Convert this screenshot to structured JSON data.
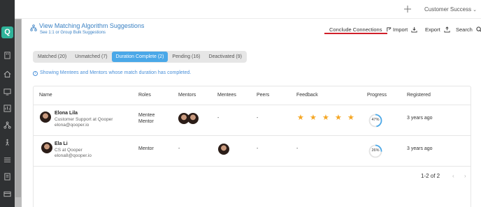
{
  "topbar": {
    "plus_icon": "plus-icon",
    "user_menu": "Customer Success"
  },
  "header": {
    "title": "View Matching Algorithm Suggestions",
    "subtitle": "See 1:1 or Group Bulk Suggestions",
    "actions": {
      "conclude": "Conclude Connections",
      "import": "Import",
      "export": "Export",
      "search": "Search"
    }
  },
  "tabs": [
    {
      "label": "Matched (20)",
      "active": false
    },
    {
      "label": "Unmatched (7)",
      "active": false
    },
    {
      "label": "Duration Complete (2)",
      "active": true
    },
    {
      "label": "Pending (16)",
      "active": false
    },
    {
      "label": "Deactivated (9)",
      "active": false
    }
  ],
  "info": "Showing Mentees and Mentors whose match duration has completed.",
  "table": {
    "columns": [
      "Name",
      "Roles",
      "Mentors",
      "Mentees",
      "Peers",
      "Feedback",
      "Progress",
      "Registered"
    ],
    "rows": [
      {
        "name": "Elona Lila",
        "title": "Customer Support at Qooper",
        "email": "elona@qooper.io",
        "roles": [
          "Mentee",
          "Mentor"
        ],
        "mentors": "",
        "mentees": "-",
        "peers": "-",
        "feedback_stars": 5,
        "progress": "47%",
        "progress_value": 47,
        "registered": "3 years ago"
      },
      {
        "name": "Ela Li",
        "title": "CS at Qooper",
        "email": "elona8@qooper.io",
        "roles": [
          "Mentor"
        ],
        "mentors": "-",
        "mentees": "",
        "peers": "-",
        "feedback": "-",
        "progress": "26%",
        "progress_value": 26,
        "registered": "3 years ago"
      }
    ]
  },
  "pagination": {
    "range": "1-2 of 2",
    "prev": "‹",
    "next": "›"
  },
  "colors": {
    "accent": "#4aa8e8",
    "link": "#3b82c4",
    "star": "#f5a623",
    "underline": "#d0202a",
    "rail": "#2f3133",
    "logo": "#2fb39a"
  }
}
